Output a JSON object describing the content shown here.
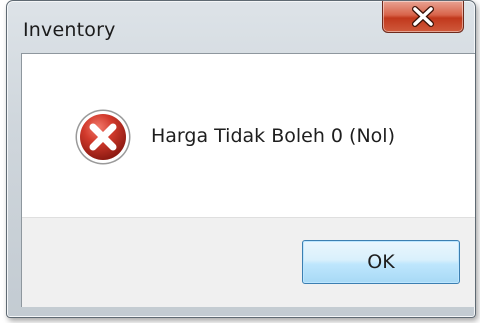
{
  "window": {
    "title": "Inventory"
  },
  "titlebar": {
    "close_icon": "close-icon"
  },
  "dialog": {
    "icon": "error-icon",
    "message": "Harga Tidak Boleh 0 (Nol)",
    "ok_label": "OK"
  },
  "colors": {
    "close_button": "#c7432a",
    "error_icon": "#c0281c",
    "ok_border": "#3c7fb1"
  }
}
